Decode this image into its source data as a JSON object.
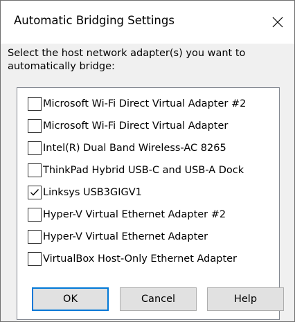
{
  "window": {
    "title": "Automatic Bridging Settings",
    "close_icon": "close-icon"
  },
  "prompt": "Select the host network adapter(s) you want to automatically bridge:",
  "adapters": [
    {
      "label": "Microsoft Wi-Fi Direct Virtual Adapter #2",
      "checked": false
    },
    {
      "label": "Microsoft Wi-Fi Direct Virtual Adapter",
      "checked": false
    },
    {
      "label": "Intel(R) Dual Band Wireless-AC 8265",
      "checked": false
    },
    {
      "label": "ThinkPad Hybrid USB-C and USB-A Dock",
      "checked": false
    },
    {
      "label": "Linksys USB3GIGV1",
      "checked": true
    },
    {
      "label": "Hyper-V Virtual Ethernet Adapter #2",
      "checked": false
    },
    {
      "label": "Hyper-V Virtual Ethernet Adapter",
      "checked": false
    },
    {
      "label": "VirtualBox Host-Only Ethernet Adapter",
      "checked": false
    }
  ],
  "buttons": {
    "ok_label": "OK",
    "cancel_label": "Cancel",
    "help_label": "Help"
  },
  "colors": {
    "accent": "#0078d7",
    "dialog_background": "#f0f0f0",
    "button_face": "#e1e1e1"
  }
}
